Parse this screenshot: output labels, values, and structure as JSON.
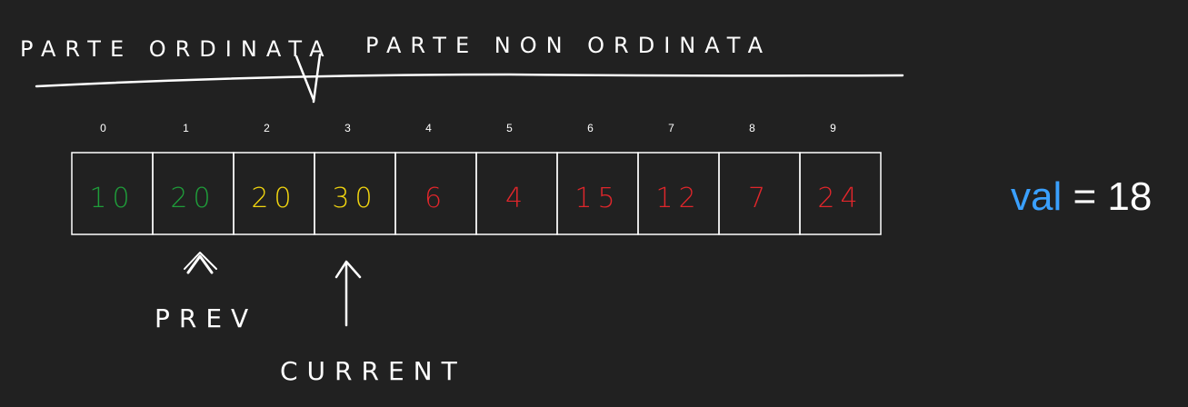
{
  "header": {
    "left_label": "PARTE ORDINATA",
    "right_label": "PARTE NON ORDINATA"
  },
  "array": {
    "indices": [
      "0",
      "1",
      "2",
      "3",
      "4",
      "5",
      "6",
      "7",
      "8",
      "9"
    ],
    "cells": [
      {
        "value": "10",
        "color": "#1f9d3a"
      },
      {
        "value": "20",
        "color": "#1f9d3a"
      },
      {
        "value": "20",
        "color": "#f2d60f"
      },
      {
        "value": "30",
        "color": "#f2d60f"
      },
      {
        "value": "6",
        "color": "#e0262b"
      },
      {
        "value": "4",
        "color": "#e0262b"
      },
      {
        "value": "15",
        "color": "#e0262b"
      },
      {
        "value": "12",
        "color": "#e0262b"
      },
      {
        "value": "7",
        "color": "#e0262b"
      },
      {
        "value": "24",
        "color": "#e0262b"
      }
    ]
  },
  "pointers": {
    "prev": "PREV",
    "current": "CURRENT"
  },
  "variable": {
    "name": "val",
    "operator": "=",
    "value": "18",
    "name_color": "#3aa0ff"
  }
}
